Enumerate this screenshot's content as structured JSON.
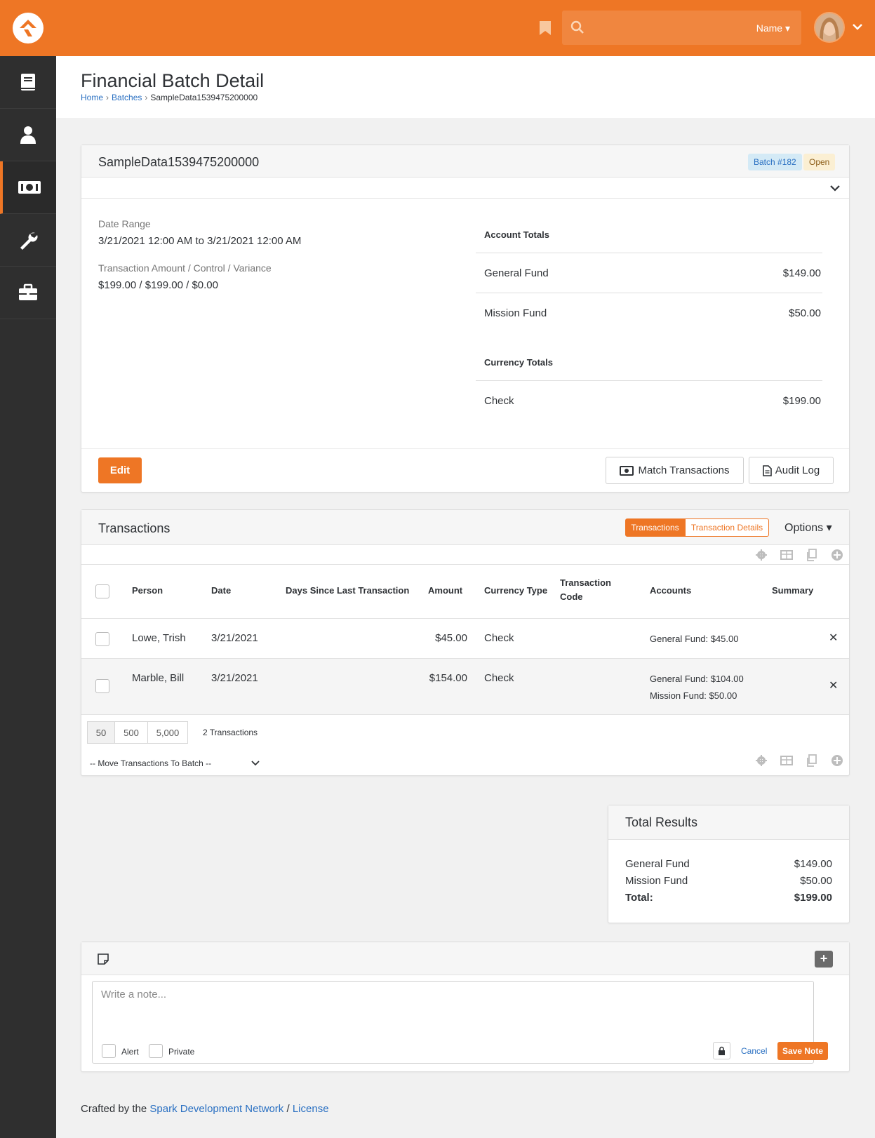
{
  "header": {
    "search_scope": "Name",
    "colors": {
      "brand": "#ee7625",
      "sidebar": "#2f2f2f",
      "link": "#2a70c2"
    }
  },
  "sidebar": {
    "items": [
      {
        "icon": "book-icon"
      },
      {
        "icon": "person-icon"
      },
      {
        "icon": "money-icon",
        "active": true
      },
      {
        "icon": "wrench-icon"
      },
      {
        "icon": "briefcase-icon"
      }
    ]
  },
  "page": {
    "title": "Financial Batch Detail",
    "breadcrumb": [
      "Home",
      "Batches",
      "SampleData1539475200000"
    ]
  },
  "batch": {
    "name": "SampleData1539475200000",
    "badge_number": "Batch #182",
    "badge_status": "Open",
    "date_range_label": "Date Range",
    "date_range_value": "3/21/2021 12:00 AM to 3/21/2021 12:00 AM",
    "amount_label": "Transaction Amount / Control / Variance",
    "amount_value": "$199.00 / $199.00 / $0.00",
    "account_totals_label": "Account Totals",
    "account_totals": [
      {
        "name": "General Fund",
        "value": "$149.00"
      },
      {
        "name": "Mission Fund",
        "value": "$50.00"
      }
    ],
    "currency_totals_label": "Currency Totals",
    "currency_totals": [
      {
        "name": "Check",
        "value": "$199.00"
      }
    ],
    "edit_label": "Edit",
    "match_label": "Match Transactions",
    "audit_label": "Audit Log"
  },
  "transactions": {
    "title": "Transactions",
    "toggle_on": "Transactions",
    "toggle_off": "Transaction Details",
    "options_label": "Options",
    "columns": {
      "person": "Person",
      "date": "Date",
      "days": "Days Since Last Transaction",
      "amount": "Amount",
      "currency": "Currency Type",
      "code_line1": "Transaction",
      "code_line2": "Code",
      "accounts": "Accounts",
      "summary": "Summary"
    },
    "rows": [
      {
        "person": "Lowe, Trish",
        "date": "3/21/2021",
        "amount": "$45.00",
        "currency": "Check",
        "accounts": [
          "General Fund: $45.00"
        ]
      },
      {
        "person": "Marble, Bill",
        "date": "3/21/2021",
        "amount": "$154.00",
        "currency": "Check",
        "accounts": [
          "General Fund: $104.00",
          "Mission Fund: $50.00"
        ]
      }
    ],
    "page_sizes": [
      "50",
      "500",
      "5,000"
    ],
    "count_label": "2 Transactions",
    "move_label": "-- Move Transactions To Batch --"
  },
  "total_results": {
    "title": "Total Results",
    "rows": [
      {
        "name": "General Fund",
        "value": "$149.00"
      },
      {
        "name": "Mission Fund",
        "value": "$50.00"
      }
    ],
    "total_label": "Total:",
    "total_value": "$199.00"
  },
  "notes": {
    "placeholder": "Write a note...",
    "alert_label": "Alert",
    "private_label": "Private",
    "cancel_label": "Cancel",
    "save_label": "Save Note"
  },
  "footer": {
    "prefix": "Crafted by the",
    "link1": "Spark Development Network",
    "sep": "/",
    "link2": "License"
  }
}
